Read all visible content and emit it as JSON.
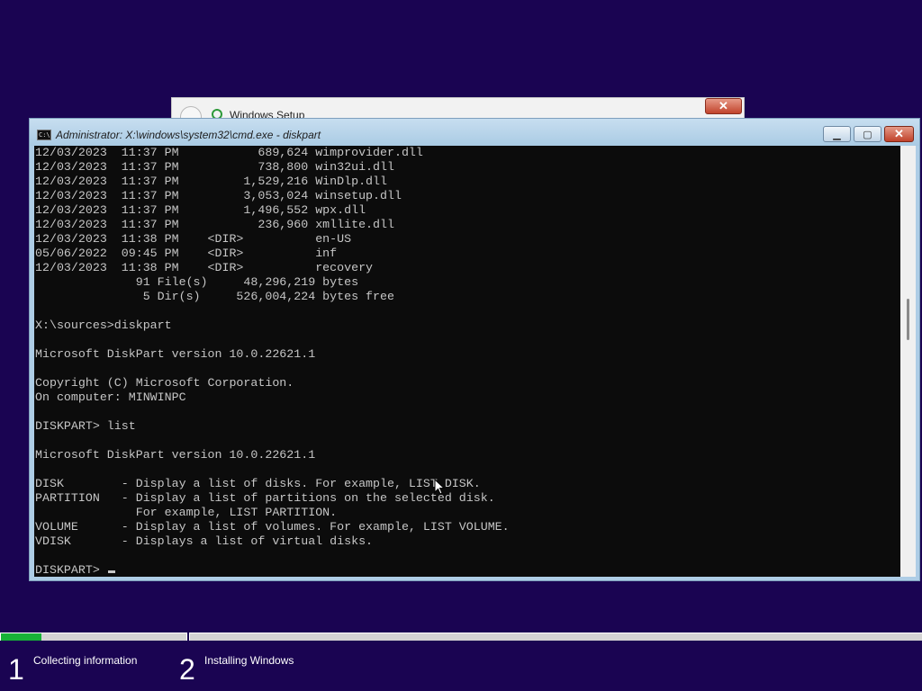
{
  "setup_window": {
    "title": "Windows Setup",
    "close_glyph": "✕"
  },
  "cmd_window": {
    "title": "Administrator: X:\\windows\\system32\\cmd.exe - diskpart",
    "icon_text": "C:\\",
    "buttons": {
      "minimize": "▁",
      "maximize": "▢",
      "close": "✕"
    }
  },
  "console": {
    "lines": [
      "12/03/2023  11:37 PM           689,624 wimprovider.dll",
      "12/03/2023  11:37 PM           738,800 win32ui.dll",
      "12/03/2023  11:37 PM         1,529,216 WinDlp.dll",
      "12/03/2023  11:37 PM         3,053,024 winsetup.dll",
      "12/03/2023  11:37 PM         1,496,552 wpx.dll",
      "12/03/2023  11:37 PM           236,960 xmllite.dll",
      "12/03/2023  11:38 PM    <DIR>          en-US",
      "05/06/2022  09:45 PM    <DIR>          inf",
      "12/03/2023  11:38 PM    <DIR>          recovery",
      "              91 File(s)     48,296,219 bytes",
      "               5 Dir(s)     526,004,224 bytes free",
      "",
      "X:\\sources>diskpart",
      "",
      "Microsoft DiskPart version 10.0.22621.1",
      "",
      "Copyright (C) Microsoft Corporation.",
      "On computer: MINWINPC",
      "",
      "DISKPART> list",
      "",
      "Microsoft DiskPart version 10.0.22621.1",
      "",
      "DISK        - Display a list of disks. For example, LIST DISK.",
      "PARTITION   - Display a list of partitions on the selected disk.",
      "              For example, LIST PARTITION.",
      "VOLUME      - Display a list of volumes. For example, LIST VOLUME.",
      "VDISK       - Displays a list of virtual disks.",
      "",
      "DISKPART> "
    ]
  },
  "progress": {
    "fraction_step1": 0.22,
    "fill_color": "#17b237"
  },
  "steps": [
    {
      "number": "1",
      "label": "Collecting information"
    },
    {
      "number": "2",
      "label": "Installing Windows"
    }
  ],
  "colors": {
    "background": "#1a0452",
    "console_bg": "#0c0c0c",
    "console_text": "#c6c6c6",
    "titlebar": "#aecde6"
  }
}
